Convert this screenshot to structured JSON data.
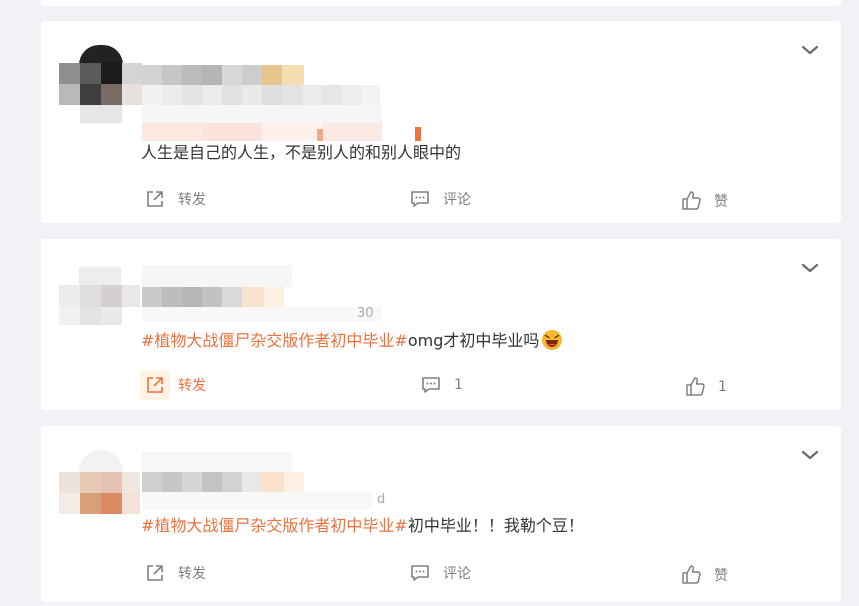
{
  "posts": [
    {
      "text": "人生是自己的人生，不是别人的和别人眼中的",
      "hashtag": "",
      "forward_label": "转发",
      "comment_label": "评论",
      "like_label": "赞"
    },
    {
      "hashtag": "#植物大战僵尸杂交版作者初中毕业#",
      "text": "omg才初中毕业吗",
      "emoji": "grinning-face-emoji",
      "forward_label": "转发",
      "comment_count": "1",
      "like_count": "1",
      "partial_meta": "30"
    },
    {
      "hashtag": "#植物大战僵尸杂交版作者初中毕业#",
      "text": "初中毕业！！我勒个豆！",
      "forward_label": "转发",
      "comment_label": "评论",
      "like_label": "赞",
      "partial_meta": "d"
    }
  ],
  "colors": {
    "accent": "#eb7340",
    "background": "#f1f2f5",
    "card": "#ffffff",
    "text": "#333333",
    "muted": "#808080"
  },
  "icons": [
    "chevron-down-icon",
    "forward-icon",
    "comment-icon",
    "thumbs-up-icon"
  ]
}
